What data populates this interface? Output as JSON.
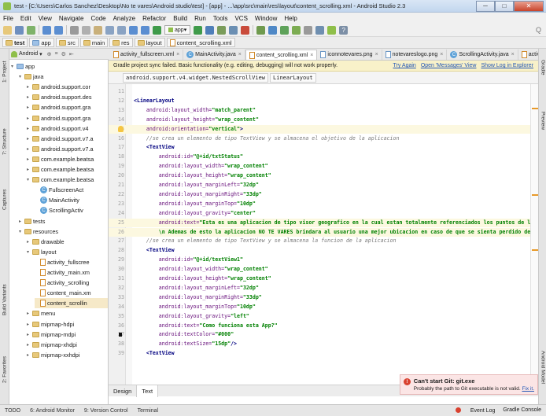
{
  "window": {
    "title": "test - [C:\\Users\\Carlos Sanchez\\Desktop\\No te vares\\Android studio\\test] - [app] - ...\\app\\src\\main\\res\\layout\\content_scrolling.xml - Android Studio 2.3",
    "controls": [
      "─",
      "□",
      "✕"
    ]
  },
  "menu": [
    "File",
    "Edit",
    "View",
    "Navigate",
    "Code",
    "Analyze",
    "Refactor",
    "Build",
    "Run",
    "Tools",
    "VCS",
    "Window",
    "Help"
  ],
  "toolbar": {
    "run_config": "app",
    "icons": [
      "open-icon",
      "save-icon",
      "sync-icon",
      "back-icon",
      "forward-icon",
      "cut-icon",
      "copy-icon",
      "paste-icon",
      "find-icon",
      "replace-icon",
      "nav-back-icon",
      "nav-forward-icon",
      "make-icon",
      "run-icon",
      "debug-icon",
      "profile-icon",
      "attach-icon",
      "stop-icon",
      "sync-gradle-icon",
      "avd-icon",
      "sdk-icon",
      "monitor-icon",
      "structure-icon",
      "help-icon"
    ],
    "search_glyph": "Q"
  },
  "breadcrumb": [
    "test",
    "app",
    "src",
    "main",
    "res",
    "layout",
    "content_scrolling.xml"
  ],
  "left_panel_tabs": [
    "1: Project",
    "7: Structure",
    "Captures",
    "Build Variants",
    "2: Favorites"
  ],
  "right_panel_tabs": [
    "Gradle",
    "Preview",
    "Android Model"
  ],
  "project_panel": {
    "view_selector": "Android",
    "tree": [
      {
        "label": "app",
        "depth": 0,
        "kind": "folder",
        "expanded": true
      },
      {
        "label": "java",
        "depth": 1,
        "kind": "folder",
        "expanded": true
      },
      {
        "label": "android.support.cor",
        "depth": 2,
        "kind": "folder"
      },
      {
        "label": "android.support.des",
        "depth": 2,
        "kind": "folder"
      },
      {
        "label": "android.support.gra",
        "depth": 2,
        "kind": "folder"
      },
      {
        "label": "android.support.gra",
        "depth": 2,
        "kind": "folder"
      },
      {
        "label": "android.support.v4",
        "depth": 2,
        "kind": "folder"
      },
      {
        "label": "android.support.v7.a",
        "depth": 2,
        "kind": "folder"
      },
      {
        "label": "android.support.v7.a",
        "depth": 2,
        "kind": "folder"
      },
      {
        "label": "com.example.beatsa",
        "depth": 2,
        "kind": "folder"
      },
      {
        "label": "com.example.beatsa",
        "depth": 2,
        "kind": "folder"
      },
      {
        "label": "com.example.beatsa",
        "depth": 2,
        "kind": "folder",
        "expanded": true
      },
      {
        "label": "FullscreenAct",
        "depth": 3,
        "kind": "class"
      },
      {
        "label": "MainActivity",
        "depth": 3,
        "kind": "class"
      },
      {
        "label": "ScrollingActiv",
        "depth": 3,
        "kind": "class"
      },
      {
        "label": "tests",
        "depth": 1,
        "kind": "folder"
      },
      {
        "label": "resources",
        "depth": 1,
        "kind": "folder",
        "expanded": true
      },
      {
        "label": "drawable",
        "depth": 2,
        "kind": "folder"
      },
      {
        "label": "layout",
        "depth": 2,
        "kind": "folder",
        "expanded": true
      },
      {
        "label": "activity_fullscree",
        "depth": 3,
        "kind": "xml"
      },
      {
        "label": "activity_main.xm",
        "depth": 3,
        "kind": "xml"
      },
      {
        "label": "activity_scrolling",
        "depth": 3,
        "kind": "xml"
      },
      {
        "label": "content_main.xm",
        "depth": 3,
        "kind": "xml"
      },
      {
        "label": "content_scrollin",
        "depth": 3,
        "kind": "xml",
        "selected": true
      },
      {
        "label": "menu",
        "depth": 2,
        "kind": "folder"
      },
      {
        "label": "mipmap-hdpi",
        "depth": 2,
        "kind": "folder"
      },
      {
        "label": "mipmap-mdpi",
        "depth": 2,
        "kind": "folder"
      },
      {
        "label": "mipmap-xhdpi",
        "depth": 2,
        "kind": "folder"
      },
      {
        "label": "mipmap-xxhdpi",
        "depth": 2,
        "kind": "folder"
      }
    ]
  },
  "editor_tabs": [
    {
      "label": "activity_fullscreen.xml",
      "active": false
    },
    {
      "label": "MainActivity.java",
      "active": false
    },
    {
      "label": "content_scrolling.xml",
      "active": true
    },
    {
      "label": "iconnotevares.png",
      "active": false
    },
    {
      "label": "notevareslogo.png",
      "active": false
    },
    {
      "label": "ScrollingActivity.java",
      "active": false
    },
    {
      "label": "activity_main.xml",
      "active": false
    }
  ],
  "editor_tabs_more": "»3",
  "sync_banner": {
    "message": "Gradle project sync failed. Basic functionality (e.g. editing, debugging) will not work properly.",
    "links": [
      "Try Again",
      "Open 'Messages' View",
      "Show Log in Explorer"
    ]
  },
  "xml_path": [
    "android.support.v4.widget.NestedScrollView",
    "LinearLayout"
  ],
  "code_lines": [
    {
      "n": "11",
      "segs": []
    },
    {
      "n": "12",
      "segs": [
        {
          "t": "tag",
          "s": "<LinearLayout"
        }
      ]
    },
    {
      "n": "13",
      "segs": [
        {
          "t": "attr",
          "s": "    android:layout_width="
        },
        {
          "t": "val",
          "s": "\"match_parent\""
        }
      ]
    },
    {
      "n": "14",
      "segs": [
        {
          "t": "attr",
          "s": "    android:layout_height="
        },
        {
          "t": "val",
          "s": "\"wrap_content\""
        }
      ]
    },
    {
      "n": "15",
      "segs": [
        {
          "t": "attr",
          "s": "    android:orientation="
        },
        {
          "t": "val",
          "s": "\"vertical\""
        },
        {
          "t": "tag",
          "s": ">"
        }
      ],
      "bulb": true,
      "hl": true
    },
    {
      "n": "16",
      "segs": [
        {
          "t": "cmt",
          "s": "    //se crea un elemento de tipo TextView y se almacena el objetivo de la aplicacion"
        }
      ]
    },
    {
      "n": "17",
      "segs": [
        {
          "t": "tag",
          "s": "    <TextView"
        }
      ]
    },
    {
      "n": "18",
      "segs": [
        {
          "t": "attr",
          "s": "        android:id="
        },
        {
          "t": "val",
          "s": "\"@+id/txtStatus\""
        }
      ]
    },
    {
      "n": "19",
      "segs": [
        {
          "t": "attr",
          "s": "        android:layout_width="
        },
        {
          "t": "val",
          "s": "\"wrap_content\""
        }
      ]
    },
    {
      "n": "20",
      "segs": [
        {
          "t": "attr",
          "s": "        android:layout_height="
        },
        {
          "t": "val",
          "s": "\"wrap_content\""
        }
      ]
    },
    {
      "n": "21",
      "segs": [
        {
          "t": "attr",
          "s": "        android:layout_marginLeft="
        },
        {
          "t": "val",
          "s": "\"32dp\""
        }
      ]
    },
    {
      "n": "22",
      "segs": [
        {
          "t": "attr",
          "s": "        android:layout_marginRight="
        },
        {
          "t": "val",
          "s": "\"33dp\""
        }
      ]
    },
    {
      "n": "23",
      "segs": [
        {
          "t": "attr",
          "s": "        android:layout_marginTop="
        },
        {
          "t": "val",
          "s": "\"10dp\""
        }
      ]
    },
    {
      "n": "24",
      "segs": [
        {
          "t": "attr",
          "s": "        android:layout_gravity="
        },
        {
          "t": "val",
          "s": "\"center\""
        }
      ]
    },
    {
      "n": "25",
      "segs": [
        {
          "t": "attr",
          "s": "        android:text="
        },
        {
          "t": "val",
          "s": "\"Esta es una aplicacion de tipo visor geografico en la cual estan totalmente referenciados los puntos de las zonas de talleres"
        }
      ],
      "hl": true
    },
    {
      "n": "26",
      "segs": [
        {
          "t": "val",
          "s": "        \\n Ademas de esto la aplicacion NO TE VARES brindara al usuario una mejor ubicacion en caso de que se sienta perdido del destino al que se d"
        }
      ],
      "hl": true
    },
    {
      "n": "27",
      "segs": [
        {
          "t": "cmt",
          "s": "    //se crea un elemento de tipo TextView y se almacena la funcion de la aplicacion"
        }
      ]
    },
    {
      "n": "28",
      "segs": [
        {
          "t": "tag",
          "s": "    <TextView"
        }
      ]
    },
    {
      "n": "29",
      "segs": [
        {
          "t": "attr",
          "s": "        android:id="
        },
        {
          "t": "val",
          "s": "\"@+id/textView1\""
        }
      ]
    },
    {
      "n": "30",
      "segs": [
        {
          "t": "attr",
          "s": "        android:layout_width="
        },
        {
          "t": "val",
          "s": "\"wrap_content\""
        }
      ]
    },
    {
      "n": "31",
      "segs": [
        {
          "t": "attr",
          "s": "        android:layout_height="
        },
        {
          "t": "val",
          "s": "\"wrap_content\""
        }
      ]
    },
    {
      "n": "32",
      "segs": [
        {
          "t": "attr",
          "s": "        android:layout_marginLeft="
        },
        {
          "t": "val",
          "s": "\"32dp\""
        }
      ]
    },
    {
      "n": "33",
      "segs": [
        {
          "t": "attr",
          "s": "        android:layout_marginRight="
        },
        {
          "t": "val",
          "s": "\"33dp\""
        }
      ]
    },
    {
      "n": "34",
      "segs": [
        {
          "t": "attr",
          "s": "        android:layout_marginTop="
        },
        {
          "t": "val",
          "s": "\"10dp\""
        }
      ]
    },
    {
      "n": "35",
      "segs": [
        {
          "t": "attr",
          "s": "        android:layout_gravity="
        },
        {
          "t": "val",
          "s": "\"left\""
        }
      ]
    },
    {
      "n": "36",
      "segs": [
        {
          "t": "attr",
          "s": "        android:text="
        },
        {
          "t": "val",
          "s": "\"Como funciona esta App?\""
        }
      ]
    },
    {
      "n": "37",
      "segs": [
        {
          "t": "attr",
          "s": "        android:textColor="
        },
        {
          "t": "val",
          "s": "\"#000\""
        }
      ],
      "bp": true
    },
    {
      "n": "38",
      "segs": [
        {
          "t": "attr",
          "s": "        android:textSize="
        },
        {
          "t": "val",
          "s": "\"15dp\""
        },
        {
          "t": "tag",
          "s": "/>"
        }
      ]
    },
    {
      "n": "39",
      "segs": [
        {
          "t": "tag",
          "s": "    <TextView"
        }
      ]
    }
  ],
  "design_tabs": [
    {
      "label": "Design",
      "active": false
    },
    {
      "label": "Text",
      "active": true
    }
  ],
  "notification": {
    "title": "Can't start Git: git.exe",
    "body": "Probably the path to Git executable is not valid.",
    "link": "Fix it."
  },
  "statusbar": {
    "left": [
      "TODO",
      "6: Android Monitor",
      "9: Version Control",
      "Terminal"
    ],
    "right": [
      "Event Log",
      "Gradle Console"
    ]
  },
  "colors": {
    "tag": "#000080",
    "attr": "#660e7a",
    "value": "#008000",
    "comment": "#7a7a7a",
    "banner_bg": "#f8f1c9",
    "error": "#d9412f"
  }
}
